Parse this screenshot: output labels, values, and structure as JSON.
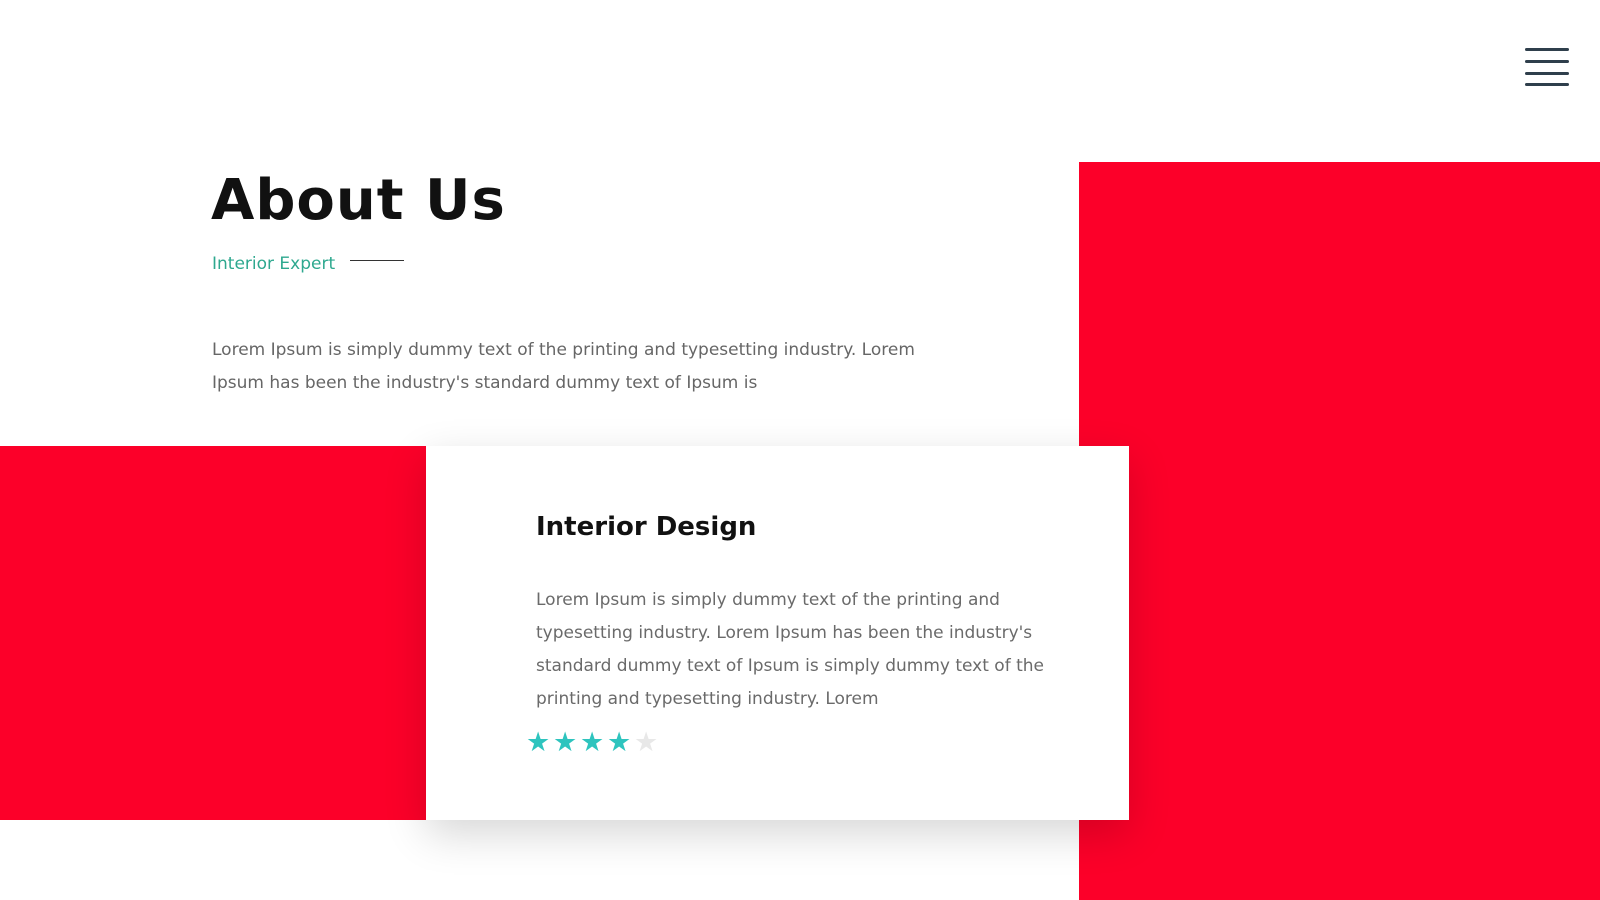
{
  "header": {
    "menu_icon": "hamburger-menu-icon"
  },
  "about": {
    "title": "About Us",
    "subtitle": "Interior Expert",
    "intro": "Lorem Ipsum is simply dummy text of the printing and typesetting industry. Lorem Ipsum has been the industry's standard dummy text of Ipsum is"
  },
  "card": {
    "title": "Interior Design",
    "text": "Lorem Ipsum is simply dummy text of the printing and typesetting industry. Lorem Ipsum has been the industry's standard dummy text of Ipsum is simply dummy text of the printing and typesetting industry. Lorem",
    "rating": 4,
    "rating_max": 5
  },
  "colors": {
    "accent_red": "#fc0029",
    "accent_teal": "#2ec4be",
    "subtitle_green": "#2ea88f",
    "star_empty": "#e8e8e8"
  }
}
